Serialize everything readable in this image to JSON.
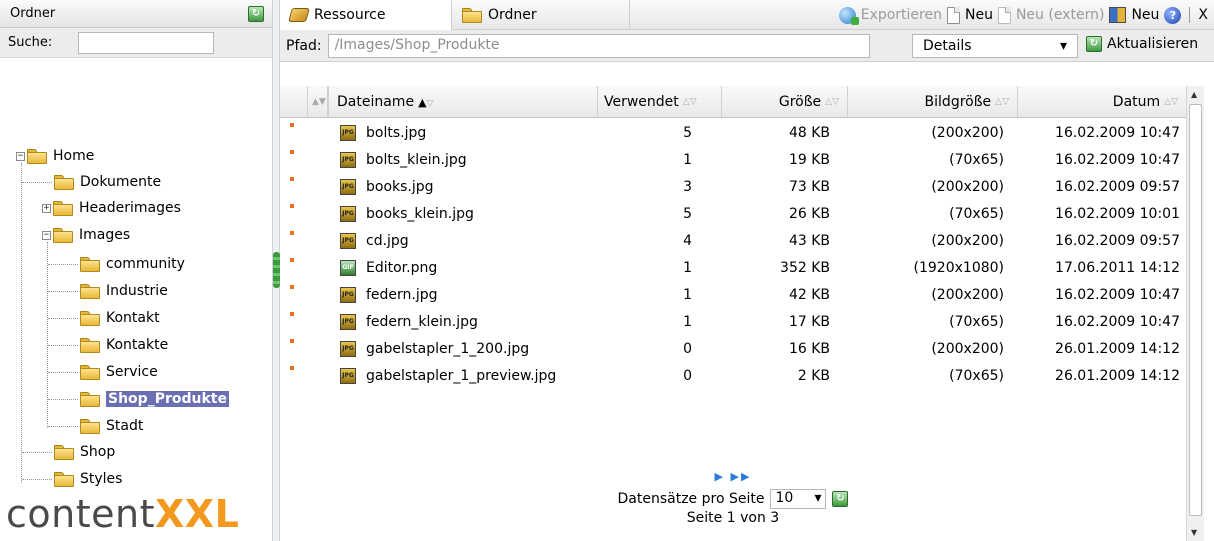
{
  "left": {
    "header_title": "Ordner",
    "search_label": "Suche:",
    "search_value": "",
    "tree": [
      {
        "label": "Home",
        "toggle": "−"
      },
      {
        "label": "Dokumente"
      },
      {
        "label": "Headerimages",
        "toggle": "+"
      },
      {
        "label": "Images",
        "toggle": "−"
      },
      {
        "label": "community"
      },
      {
        "label": "Industrie"
      },
      {
        "label": "Kontakt"
      },
      {
        "label": "Kontakte"
      },
      {
        "label": "Service"
      },
      {
        "label": "Shop_Produkte",
        "selected": true
      },
      {
        "label": "Stadt"
      },
      {
        "label": "Shop"
      },
      {
        "label": "Styles"
      }
    ],
    "logo": {
      "part1": "content",
      "part2": "XXL"
    }
  },
  "toolbar": {
    "tab_resource": "Ressource",
    "tab_folder": "Ordner",
    "export": "Exportieren",
    "new": "Neu",
    "new_external": "Neu (extern)",
    "new_book": "Neu",
    "help": "?",
    "close": "X"
  },
  "pathbar": {
    "label": "Pfad:",
    "value": "/Images/Shop_Produkte",
    "view": "Details",
    "refresh": "Aktualisieren"
  },
  "grid": {
    "columns": [
      "Dateiname",
      "Verwendet",
      "Größe",
      "Bildgröße",
      "Datum"
    ],
    "rows": [
      {
        "name": "bolts.jpg",
        "type": "JPG",
        "used": "5",
        "size": "48 KB",
        "dims": "(200x200)",
        "date": "16.02.2009 10:47"
      },
      {
        "name": "bolts_klein.jpg",
        "type": "JPG",
        "used": "1",
        "size": "19 KB",
        "dims": "(70x65)",
        "date": "16.02.2009 10:47"
      },
      {
        "name": "books.jpg",
        "type": "JPG",
        "used": "3",
        "size": "73 KB",
        "dims": "(200x200)",
        "date": "16.02.2009 09:57"
      },
      {
        "name": "books_klein.jpg",
        "type": "JPG",
        "used": "5",
        "size": "26 KB",
        "dims": "(70x65)",
        "date": "16.02.2009 10:01"
      },
      {
        "name": "cd.jpg",
        "type": "JPG",
        "used": "4",
        "size": "43 KB",
        "dims": "(200x200)",
        "date": "16.02.2009 09:57"
      },
      {
        "name": "Editor.png",
        "type": "GIF",
        "used": "1",
        "size": "352 KB",
        "dims": "(1920x1080)",
        "date": "17.06.2011 14:12"
      },
      {
        "name": "federn.jpg",
        "type": "JPG",
        "used": "1",
        "size": "42 KB",
        "dims": "(200x200)",
        "date": "16.02.2009 10:47"
      },
      {
        "name": "federn_klein.jpg",
        "type": "JPG",
        "used": "1",
        "size": "17 KB",
        "dims": "(70x65)",
        "date": "16.02.2009 10:47"
      },
      {
        "name": "gabelstapler_1_200.jpg",
        "type": "JPG",
        "used": "0",
        "size": "16 KB",
        "dims": "(200x200)",
        "date": "26.01.2009 14:12"
      },
      {
        "name": "gabelstapler_1_preview.jpg",
        "type": "JPG",
        "used": "0",
        "size": "2 KB",
        "dims": "(70x65)",
        "date": "26.01.2009 14:12"
      }
    ]
  },
  "pager": {
    "per_page_label": "Datensätze pro Seite",
    "per_page_value": "10",
    "page_info": "Seite 1 von 3"
  }
}
